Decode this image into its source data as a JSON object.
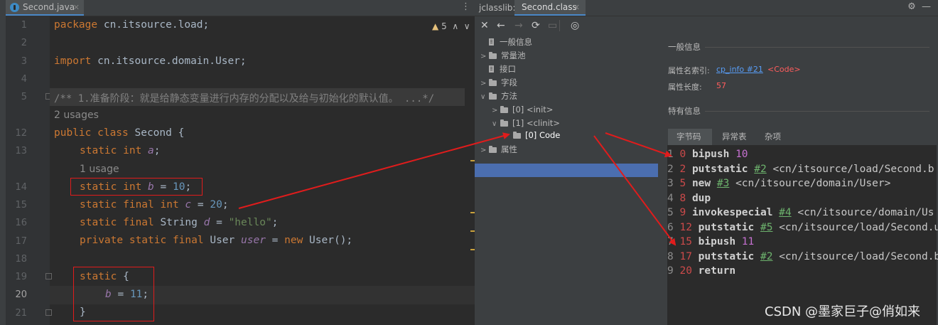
{
  "editor": {
    "tab_label": "Second.java",
    "warning_count": "5",
    "line_numbers": [
      "1",
      "2",
      "3",
      "4",
      "5",
      "12",
      "13",
      "14",
      "15",
      "16",
      "17",
      "18",
      "19",
      "20",
      "21"
    ],
    "lines": {
      "l1_kw": "package",
      "l1_rest": " cn.itsource.load;",
      "l3_kw": "import",
      "l3_rest": " cn.itsource.domain.User;",
      "l5": "/** 1.准备阶段：就是给静态变量进行内存的分配以及给与初始化的默认值。 ...*/",
      "usages2": "2 usages",
      "l12_kw": "public class",
      "l12_rest": " Second {",
      "l13_kw": "static int",
      "l13_fld": "a",
      "usage1": "1 usage",
      "l14_kw": "static int",
      "l14_fld": "b",
      "l14_num": "10",
      "l15_kw": "static final int",
      "l15_fld": "c",
      "l15_num": "20",
      "l16_kw": "static final",
      "l16_type": "String",
      "l16_fld": "d",
      "l16_str": "\"hello\"",
      "l17_kw": "private static final",
      "l17_type": "User",
      "l17_fld": "user",
      "l17_new": "new",
      "l17_call": " User();",
      "l19_kw": "static",
      "l19_rest": " {",
      "l20_fld": "b",
      "l20_num": "11",
      "l21": "}"
    }
  },
  "panel": {
    "title": "jclasslib:",
    "tab_label": "Second.class",
    "tree": [
      {
        "label": "一般信息"
      },
      {
        "label": "常量池"
      },
      {
        "label": "接口"
      },
      {
        "label": "字段"
      },
      {
        "label": "方法"
      },
      {
        "label": "[0] <init>"
      },
      {
        "label": "[1] <clinit>"
      },
      {
        "label": "[0] Code"
      },
      {
        "label": "属性"
      }
    ],
    "detail": {
      "general_header": "一般信息",
      "name_index_label": "属性名索引:",
      "name_index_link": "cp_info #21",
      "name_index_value": "<Code>",
      "length_label": "属性长度:",
      "length_value": "57",
      "specific_header": "特有信息",
      "subtabs": [
        "字节码",
        "异常表",
        "杂项"
      ]
    },
    "bytecode": [
      {
        "idx": "1",
        "off": "0",
        "op": "bipush",
        "arg": "10"
      },
      {
        "idx": "2",
        "off": "2",
        "op": "putstatic",
        "ref": "#2",
        "cls": "<cn/itsource/load/Second.b"
      },
      {
        "idx": "3",
        "off": "5",
        "op": "new",
        "ref": "#3",
        "cls": "<cn/itsource/domain/User>"
      },
      {
        "idx": "4",
        "off": "8",
        "op": "dup"
      },
      {
        "idx": "5",
        "off": "9",
        "op": "invokespecial",
        "ref": "#4",
        "cls": "<cn/itsource/domain/Us"
      },
      {
        "idx": "6",
        "off": "12",
        "op": "putstatic",
        "ref": "#5",
        "cls": "<cn/itsource/load/Second.u"
      },
      {
        "idx": "7",
        "off": "15",
        "op": "bipush",
        "arg": "11"
      },
      {
        "idx": "8",
        "off": "17",
        "op": "putstatic",
        "ref": "#2",
        "cls": "<cn/itsource/load/Second.b"
      },
      {
        "idx": "9",
        "off": "20",
        "op": "return"
      }
    ]
  },
  "watermark": "CSDN @墨家巨子@俏如来",
  "colors": {
    "accent": "#4a88c7",
    "highlight_box": "#e01c1c",
    "selection": "#4b6eaf"
  }
}
